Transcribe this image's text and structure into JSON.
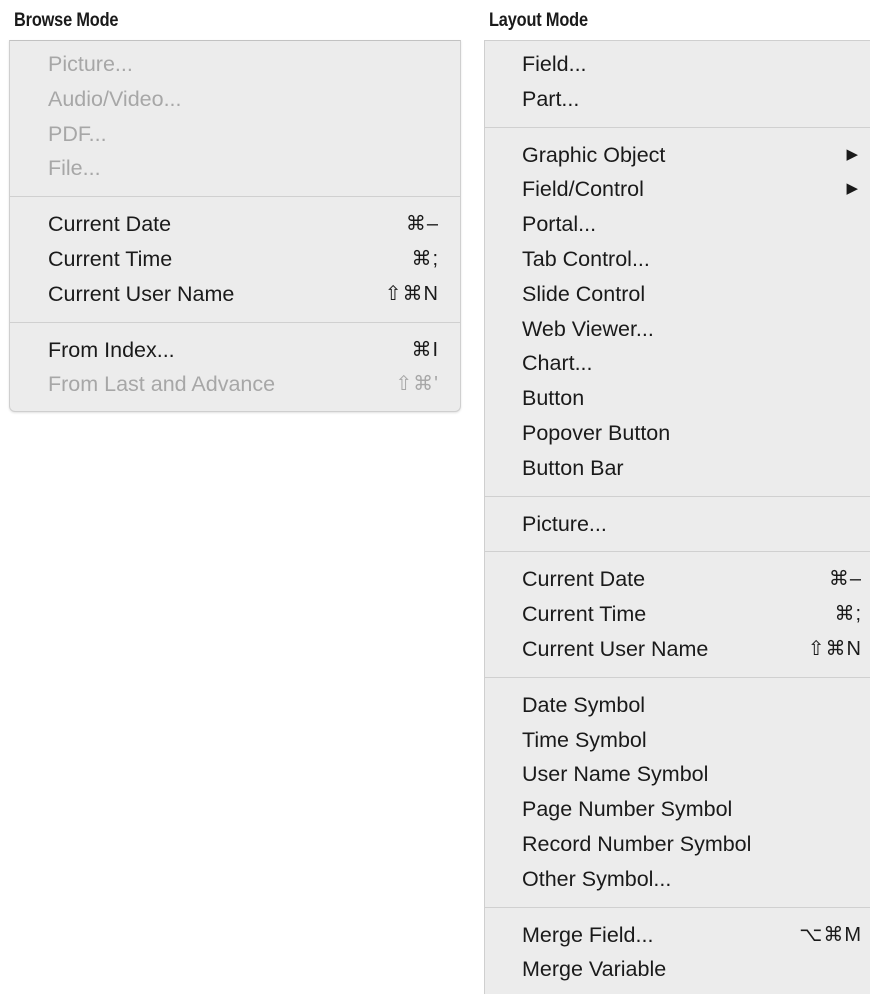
{
  "captions": {
    "browse": "Browse Mode",
    "layout": "Layout Mode"
  },
  "browse_menu": {
    "groups": [
      [
        {
          "label": "Picture...",
          "shortcut": "",
          "disabled": true
        },
        {
          "label": "Audio/Video...",
          "shortcut": "",
          "disabled": true
        },
        {
          "label": "PDF...",
          "shortcut": "",
          "disabled": true
        },
        {
          "label": "File...",
          "shortcut": "",
          "disabled": true
        }
      ],
      [
        {
          "label": "Current Date",
          "shortcut": "⌘–",
          "disabled": false
        },
        {
          "label": "Current Time",
          "shortcut": "⌘;",
          "disabled": false
        },
        {
          "label": "Current User Name",
          "shortcut": "⇧⌘N",
          "disabled": false
        }
      ],
      [
        {
          "label": "From Index...",
          "shortcut": "⌘I",
          "disabled": false
        },
        {
          "label": "From Last and Advance",
          "shortcut": "⇧⌘'",
          "disabled": true
        }
      ]
    ]
  },
  "layout_menu": {
    "groups": [
      [
        {
          "label": "Field...",
          "shortcut": "",
          "submenu": false
        },
        {
          "label": "Part...",
          "shortcut": "",
          "submenu": false
        }
      ],
      [
        {
          "label": "Graphic Object",
          "shortcut": "",
          "submenu": true
        },
        {
          "label": "Field/Control",
          "shortcut": "",
          "submenu": true
        },
        {
          "label": "Portal...",
          "shortcut": "",
          "submenu": false
        },
        {
          "label": "Tab Control...",
          "shortcut": "",
          "submenu": false
        },
        {
          "label": "Slide Control",
          "shortcut": "",
          "submenu": false
        },
        {
          "label": "Web Viewer...",
          "shortcut": "",
          "submenu": false
        },
        {
          "label": "Chart...",
          "shortcut": "",
          "submenu": false
        },
        {
          "label": "Button",
          "shortcut": "",
          "submenu": false
        },
        {
          "label": "Popover Button",
          "shortcut": "",
          "submenu": false
        },
        {
          "label": "Button Bar",
          "shortcut": "",
          "submenu": false
        }
      ],
      [
        {
          "label": "Picture...",
          "shortcut": "",
          "submenu": false
        }
      ],
      [
        {
          "label": "Current Date",
          "shortcut": "⌘–",
          "submenu": false
        },
        {
          "label": "Current Time",
          "shortcut": "⌘;",
          "submenu": false
        },
        {
          "label": "Current User Name",
          "shortcut": "⇧⌘N",
          "submenu": false
        }
      ],
      [
        {
          "label": "Date Symbol",
          "shortcut": "",
          "submenu": false
        },
        {
          "label": "Time Symbol",
          "shortcut": "",
          "submenu": false
        },
        {
          "label": "User Name Symbol",
          "shortcut": "",
          "submenu": false
        },
        {
          "label": "Page Number Symbol",
          "shortcut": "",
          "submenu": false
        },
        {
          "label": "Record Number Symbol",
          "shortcut": "",
          "submenu": false
        },
        {
          "label": "Other Symbol...",
          "shortcut": "",
          "submenu": false
        }
      ],
      [
        {
          "label": "Merge Field...",
          "shortcut": "⌥⌘M",
          "submenu": false
        },
        {
          "label": "Merge Variable",
          "shortcut": "",
          "submenu": false
        }
      ]
    ],
    "submenu_glyph": "▶"
  }
}
